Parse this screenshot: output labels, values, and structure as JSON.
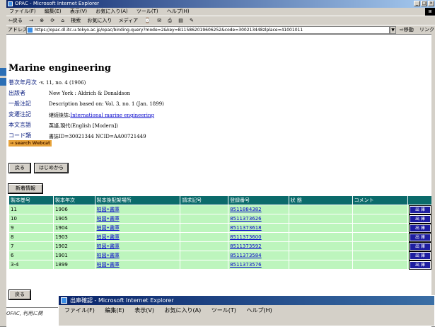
{
  "window": {
    "title": "OPAC - Microsoft Internet Explorer"
  },
  "menu": [
    "ファイル(F)",
    "編集(E)",
    "表示(V)",
    "お気に入り(A)",
    "ツール(T)",
    "ヘルプ(H)"
  ],
  "toolbar": [
    "⇦戻る",
    "→",
    "⊗",
    "⟳",
    "⌂",
    "検索",
    "お気に入り",
    "メディア",
    "⌚",
    "✉",
    "⎙",
    "▤",
    "✎"
  ],
  "address": {
    "label": "アドレス(D)",
    "url": "https://opac.dl.itc.u-tokyo.ac.jp/opac/binding-query?mode=2&key=B115862019606252&code=300213448zlplace=41001011",
    "go": "移動",
    "links": "リンク"
  },
  "record": {
    "title": "Marine engineering",
    "fields": [
      {
        "label": "巻次年月次",
        "value": "-v. 11, no. 4 (1906)"
      },
      {
        "label": "出版者",
        "value": "New York : Aldrich & Donaldson"
      },
      {
        "label": "一般注記",
        "value": "Description based on: Vol. 3, no. 1 (Jan. 1899)"
      },
      {
        "label": "変遷注記",
        "value_prefix": "継続後誌:",
        "value_link": "International marine engineering"
      },
      {
        "label": "本文言語",
        "value": "英語,現代(English [Modern])"
      },
      {
        "label": "コード類",
        "value": "書誌ID=30021344    NCID=AA00721449"
      }
    ],
    "webcat": "→ search Webcat"
  },
  "buttons": {
    "back": "戻る",
    "first": "はじめから",
    "new_info": "新着情報",
    "back2": "戻る"
  },
  "holdings": {
    "headers": [
      "製本巻号",
      "製本年次",
      "製本後配架場所",
      "請求記号",
      "登録番号",
      "状 態",
      "コメント",
      ""
    ],
    "rows": [
      {
        "vol": "11",
        "year": "1906",
        "loc": "柏図•書庫",
        "call": "",
        "reg": "8511884382",
        "status": "",
        "comment": "",
        "action": "出 庫"
      },
      {
        "vol": "10",
        "year": "1905",
        "loc": "柏図•書庫",
        "call": "",
        "reg": "8511373626",
        "status": "",
        "comment": "",
        "action": "出 庫"
      },
      {
        "vol": "9",
        "year": "1904",
        "loc": "柏図•書庫",
        "call": "",
        "reg": "8511373618",
        "status": "",
        "comment": "",
        "action": "出 庫"
      },
      {
        "vol": "8",
        "year": "1903",
        "loc": "柏図•書庫",
        "call": "",
        "reg": "8511373600",
        "status": "",
        "comment": "",
        "action": "出 庫"
      },
      {
        "vol": "7",
        "year": "1902",
        "loc": "柏図•書庫",
        "call": "",
        "reg": "8511373592",
        "status": "",
        "comment": "",
        "action": "出 庫"
      },
      {
        "vol": "6",
        "year": "1901",
        "loc": "柏図•書庫",
        "call": "",
        "reg": "8511373584",
        "status": "",
        "comment": "",
        "action": "出 庫"
      },
      {
        "vol": "3-4",
        "year": "1899",
        "loc": "柏図•書庫",
        "call": "",
        "reg": "8511373576",
        "status": "",
        "comment": "",
        "action": "出 庫"
      }
    ]
  },
  "footer_text": "OFAC, 利用に関",
  "popup": {
    "title": "出庫確認 - Microsoft Internet Explorer",
    "menu": [
      "ファイル(F)",
      "編集(E)",
      "表示(V)",
      "お気に入り(A)",
      "ツール(T)",
      "ヘルプ(H)"
    ]
  },
  "colors": {
    "header_teal": "#0b6b6b",
    "row_green": "#bdf5bd",
    "title_blue": "#0a246a",
    "label_blue": "#0a1e80"
  }
}
